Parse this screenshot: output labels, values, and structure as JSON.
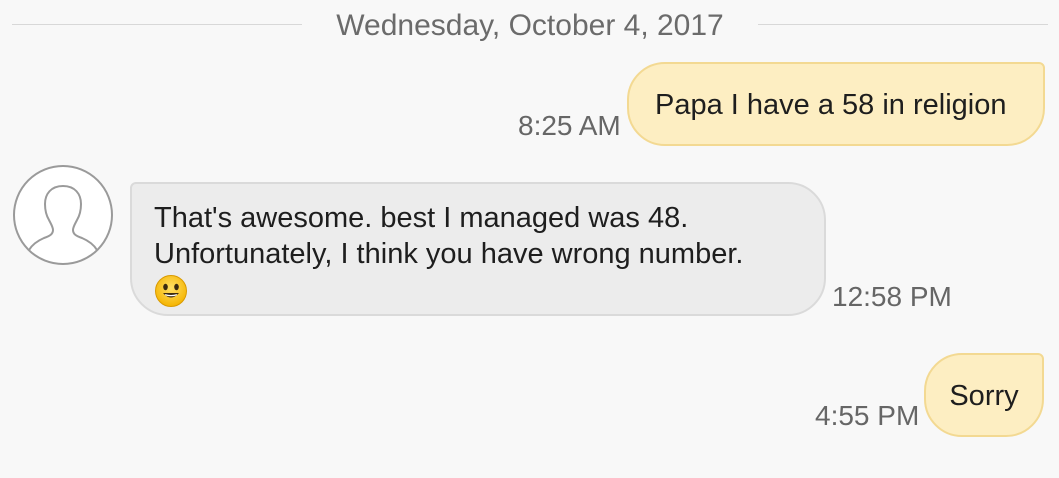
{
  "conversation": {
    "date": "Wednesday, October 4, 2017",
    "messages": [
      {
        "direction": "outgoing",
        "text": "Papa I have a 58 in religion",
        "time": "8:25 AM"
      },
      {
        "direction": "incoming",
        "lines": [
          "That's awesome. best I managed was 48.",
          "Unfortunately, I think you have wrong number."
        ],
        "emoji": "smiling-face-emoji",
        "time": "12:58 PM"
      },
      {
        "direction": "outgoing",
        "text": "Sorry",
        "time": "4:55 PM"
      }
    ]
  },
  "icons": {
    "avatar": "contact-avatar-icon",
    "emoji": "smiling-face-emoji"
  },
  "colors": {
    "background": "#f8f8f8",
    "outgoing_bubble": "#fdeec2",
    "outgoing_border": "#f3d992",
    "incoming_bubble": "#ececec",
    "incoming_border": "#dadada",
    "timestamp": "#666666"
  }
}
